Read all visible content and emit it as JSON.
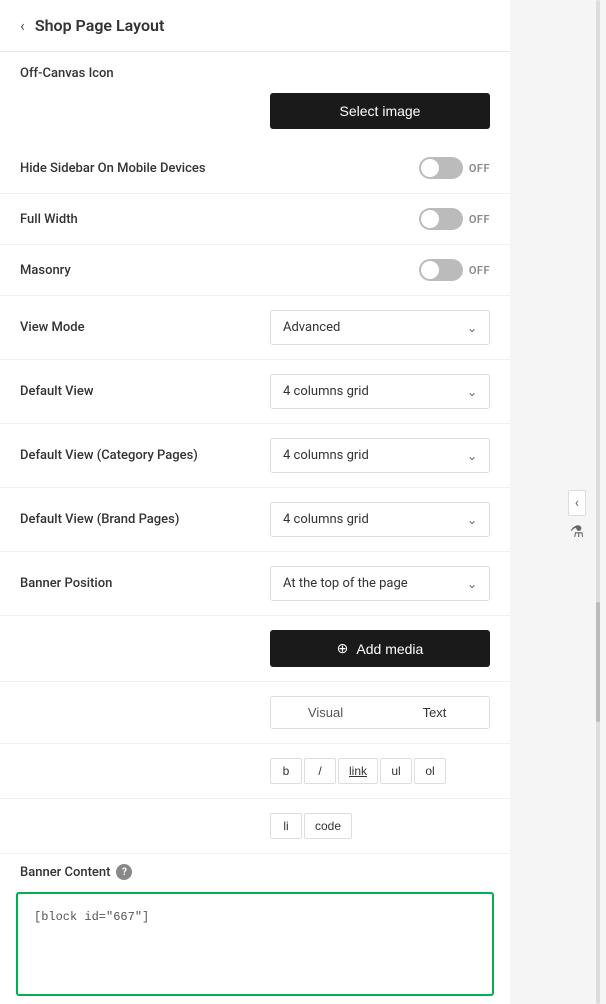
{
  "header": {
    "back_label": "‹",
    "title": "Shop Page Layout"
  },
  "offCanvas": {
    "label": "Off-Canvas Icon",
    "button_label": "Select image"
  },
  "hideSidebar": {
    "label": "Hide Sidebar On Mobile Devices",
    "toggle_state": "OFF"
  },
  "fullWidth": {
    "label": "Full Width",
    "toggle_state": "OFF"
  },
  "masonry": {
    "label": "Masonry",
    "toggle_state": "OFF"
  },
  "viewMode": {
    "label": "View Mode",
    "value": "Advanced"
  },
  "defaultView": {
    "label": "Default View",
    "value": "4 columns grid"
  },
  "defaultViewCategory": {
    "label": "Default View (Category Pages)",
    "value": "4 columns grid"
  },
  "defaultViewBrand": {
    "label": "Default View (Brand Pages)",
    "value": "4 columns grid"
  },
  "bannerPosition": {
    "label": "Banner Position",
    "value": "At the top of the page"
  },
  "addMedia": {
    "button_label": "Add media",
    "icon": "⊕"
  },
  "editor": {
    "tab_visual": "Visual",
    "tab_text": "Text",
    "toolbar": {
      "bold": "b",
      "italic": "/",
      "link": "link",
      "ul": "ul",
      "ol": "ol",
      "li": "li",
      "code": "code"
    }
  },
  "bannerContent": {
    "label": "Banner Content",
    "content": "[block id=\"667\"]"
  }
}
